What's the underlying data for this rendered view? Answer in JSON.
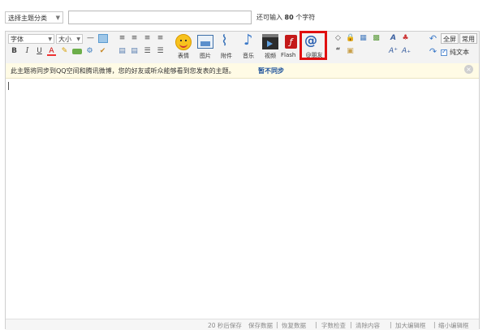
{
  "top": {
    "category_select": "选择主题分类",
    "title_placeholder": "",
    "remaining_prefix": "还可输入",
    "remaining_count": "80",
    "remaining_suffix": "个字符"
  },
  "toolbar": {
    "font_select": "字体",
    "size_select": "大小",
    "format_row2": [
      "B",
      "I",
      "U",
      "A"
    ],
    "big_buttons": [
      "表情",
      "图片",
      "附件",
      "音乐",
      "视频",
      "Flash",
      "@朋友"
    ],
    "full_screen": "全屏",
    "common": "常用",
    "plain_text": "纯文本"
  },
  "notice": {
    "text": "此主题将同步到QQ空间和腾讯微博，您的好友或听众能够看到您发表的主题。",
    "link": "暂不同步",
    "close": "×"
  },
  "statusbar": {
    "autosave": "20 秒后保存",
    "save_data": "保存数据",
    "restore_data": "恢复数据",
    "word_check": "字数检查",
    "clear_content": "清除内容",
    "enlarge": "加大编辑框",
    "shrink": "缩小编辑框"
  },
  "colors": {
    "highlight_box": "#e01010",
    "link": "#1a4f9a",
    "notice_bg": "#fffbe5"
  }
}
